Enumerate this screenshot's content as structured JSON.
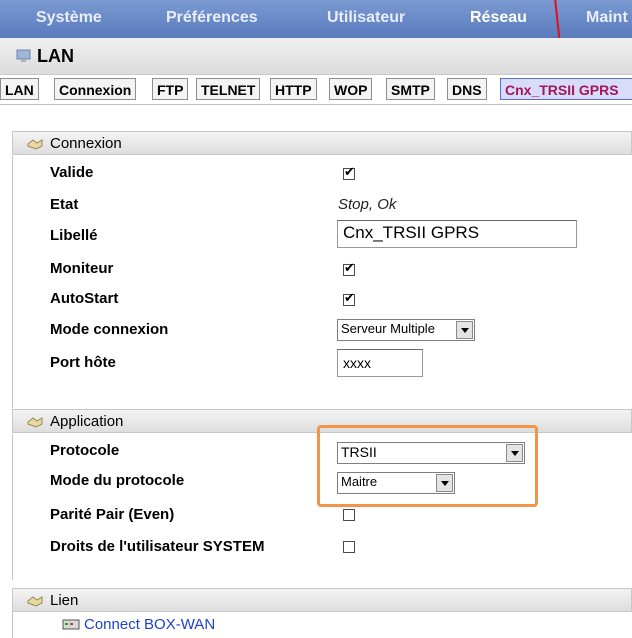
{
  "menu": {
    "items": [
      "Système",
      "Préférences",
      "Utilisateur",
      "Réseau",
      "Maint"
    ]
  },
  "page_title": "LAN",
  "tabs": [
    "LAN",
    "Connexion",
    "FTP",
    "TELNET",
    "HTTP",
    "WOP",
    "SMTP",
    "DNS",
    "Cnx_TRSII GPRS"
  ],
  "sections": {
    "connexion": {
      "title": "Connexion",
      "rows": {
        "valide": {
          "label": "Valide",
          "checked": true
        },
        "etat": {
          "label": "Etat",
          "value": "Stop, Ok"
        },
        "libelle": {
          "label": "Libellé",
          "value": "Cnx_TRSII GPRS"
        },
        "moniteur": {
          "label": "Moniteur",
          "checked": true
        },
        "autostart": {
          "label": "AutoStart",
          "checked": true
        },
        "mode_connexion": {
          "label": "Mode connexion",
          "value": "Serveur Multiple"
        },
        "port_hote": {
          "label": "Port hôte",
          "value": "xxxx"
        }
      }
    },
    "application": {
      "title": "Application",
      "rows": {
        "protocole": {
          "label": "Protocole",
          "value": "TRSII"
        },
        "mode_protocole": {
          "label": "Mode du protocole",
          "value": "Maitre"
        },
        "parite": {
          "label": "Parité Pair (Even)",
          "checked": false
        },
        "droits": {
          "label": "Droits de l'utilisateur SYSTEM",
          "checked": false
        }
      }
    },
    "lien": {
      "title": "Lien",
      "link": "Connect BOX-WAN"
    }
  },
  "colors": {
    "menu_bg": "#5a7bbd",
    "active_tab_text": "#a0185c",
    "highlight": "#f0964a",
    "link": "#1f3fd2",
    "arrow": "#e0101a"
  }
}
